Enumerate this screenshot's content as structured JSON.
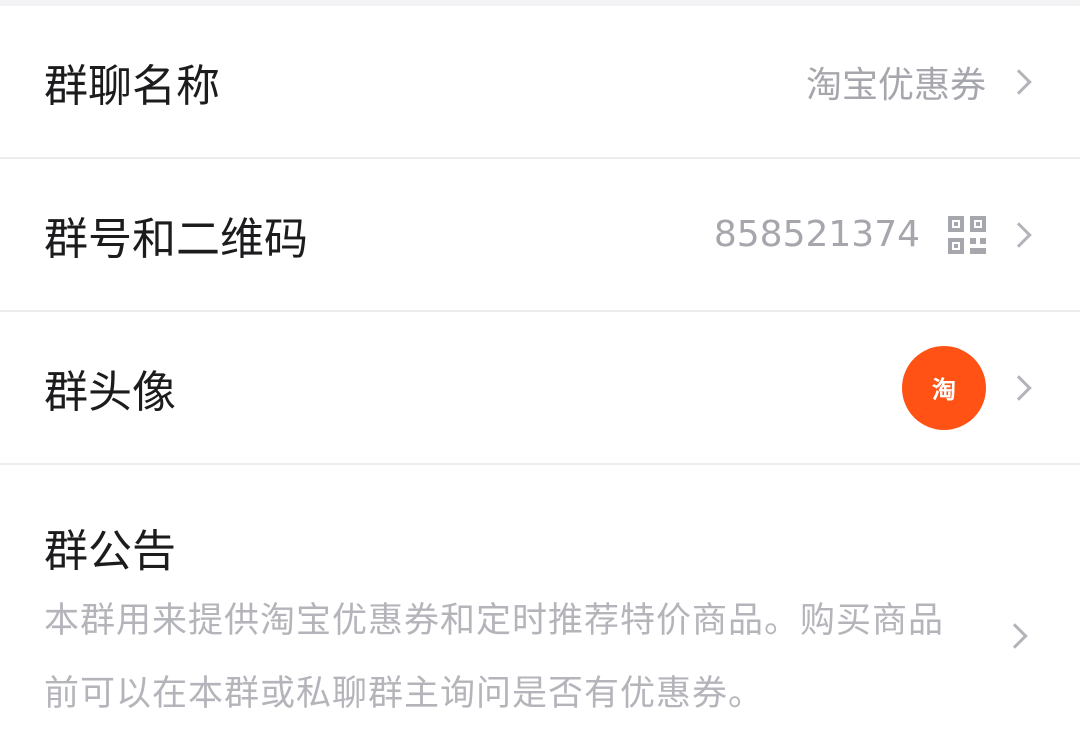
{
  "settings": {
    "group_name": {
      "label": "群聊名称",
      "value": "淘宝优惠券"
    },
    "group_id": {
      "label": "群号和二维码",
      "value": "858521374",
      "icon": "qr-code-icon"
    },
    "group_avatar": {
      "label": "群头像",
      "avatar_text": "淘",
      "avatar_color": "#ff5214"
    },
    "announcement": {
      "label": "群公告",
      "text": "本群用来提供淘宝优惠券和定时推荐特价商品。购买商品前可以在本群或私聊群主询问是否有优惠券。"
    }
  }
}
